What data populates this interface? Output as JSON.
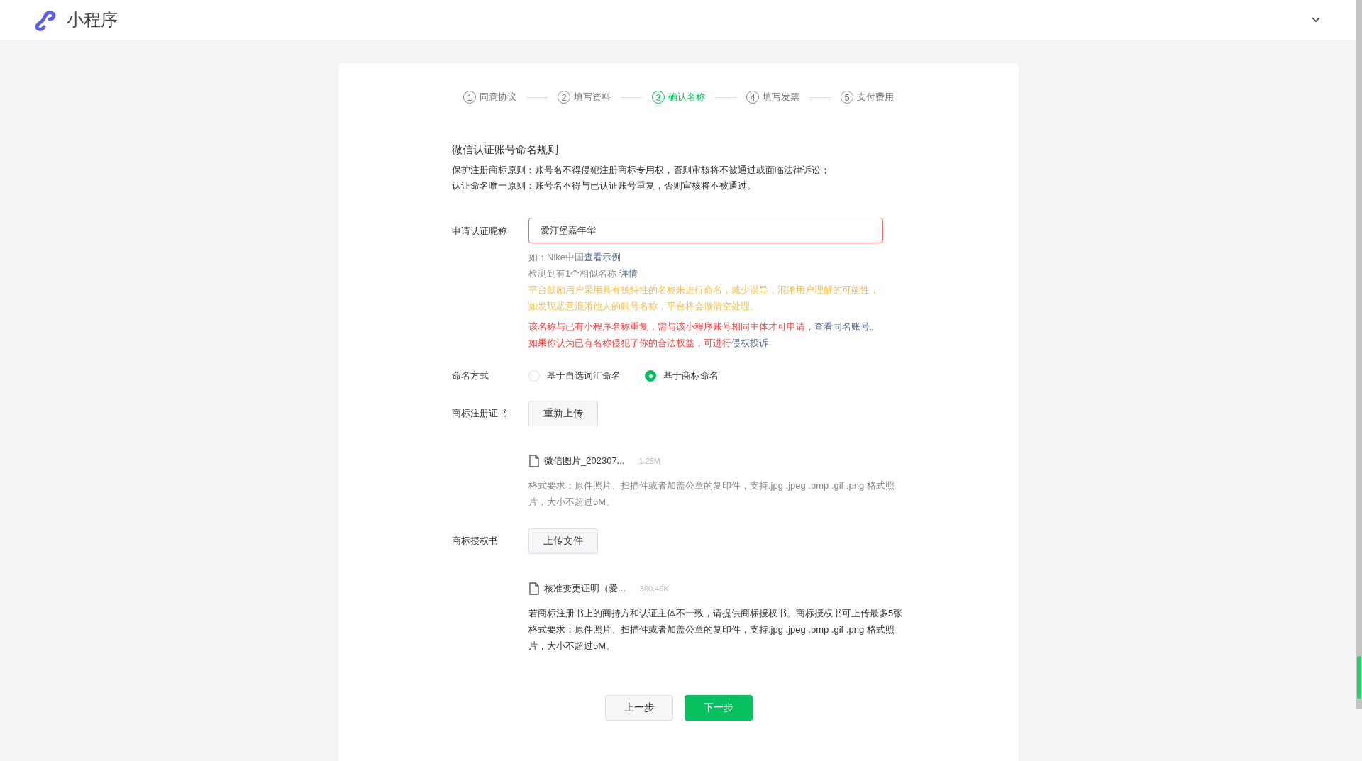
{
  "header": {
    "title": "小程序"
  },
  "steps": [
    {
      "number": "1",
      "label": "同意协议",
      "selected": false
    },
    {
      "number": "2",
      "label": "填写资料",
      "selected": false
    },
    {
      "number": "3",
      "label": "确认名称",
      "selected": true
    },
    {
      "number": "4",
      "label": "填写发票",
      "selected": false
    },
    {
      "number": "5",
      "label": "支付费用",
      "selected": false
    }
  ],
  "rules": {
    "title": "微信认证账号命名规则",
    "lines": [
      "保护注册商标原则：账号名不得侵犯注册商标专用权，否则审核将不被通过或面临法律诉讼；",
      "认证命名唯一原则：账号名不得与已认证账号重复，否则审核将不被通过。"
    ]
  },
  "nickname": {
    "label": "申请认证昵称",
    "value": "爱汀堡嘉年华",
    "error": true,
    "hints": [
      {
        "color": "#888888",
        "parts": [
          {
            "text": "如：Nike中国"
          },
          {
            "link": "查看示例"
          }
        ]
      },
      {
        "color": "#888888",
        "parts": [
          {
            "text": "检测到有1个相似名称 "
          },
          {
            "link": "详情"
          }
        ]
      },
      {
        "color": "#f7c04a",
        "parts": [
          {
            "text": "平台鼓励用户采用具有独特性的名称来进行命名，减少误导，混淆用户理解的可能性，"
          }
        ]
      },
      {
        "color": "#f7c04a",
        "parts": [
          {
            "text": "如发现恶意混淆他人的账号名称，平台将会做清空处理。"
          }
        ]
      }
    ],
    "notices": [
      {
        "color": "#f04545",
        "parts": [
          {
            "text": "该名称与已有小程序名称重复，需与该小程序账号相同主体才可申请，"
          },
          {
            "link": "查看同名账号。"
          }
        ]
      },
      {
        "color": "#f04545",
        "parts": [
          {
            "text": "如果你认为已有名称侵犯了你的合法权益，可进行"
          },
          {
            "link": "侵权投诉"
          }
        ]
      }
    ]
  },
  "naming": {
    "label": "命名方式",
    "options": [
      {
        "label": "基于自选词汇命名",
        "selected": false
      },
      {
        "label": "基于商标命名",
        "selected": true
      }
    ]
  },
  "uploads": [
    {
      "label": "商标注册证书",
      "button": "重新上传",
      "file": {
        "name": "微信图片_202307...",
        "size": "1.25M"
      },
      "notes": [
        {
          "text": "格式要求：原件照片、扫描件或者加盖公章的复印件，支持.jpg .jpeg .bmp .gif .png 格式照片，大小不超过5M。",
          "color": "#888888"
        }
      ]
    },
    {
      "label": "商标授权书",
      "button": "上传文件",
      "file": {
        "name": "核准变更证明（爱...",
        "size": "300.46K"
      },
      "notes": [
        {
          "text": "若商标注册书上的商持方和认证主体不一致，请提供商标授权书。商标授权书可上传最多5张",
          "color": "#333333"
        },
        {
          "text": "格式要求：原件照片、扫描件或者加盖公章的复印件，支持.jpg .jpeg .bmp .gif .png 格式照片，大小不超过5M。",
          "color": "#333333"
        }
      ]
    }
  ],
  "actions": {
    "back": "上一步",
    "next": "下一步"
  }
}
